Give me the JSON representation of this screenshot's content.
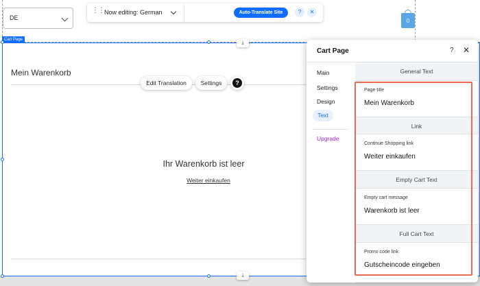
{
  "language_selector": {
    "value": "DE"
  },
  "toolbar": {
    "editing_label": "Now editing: German",
    "auto_translate_label": "Auto-Translate Site",
    "help_label": "?",
    "close_label": "✕"
  },
  "cart_icon": {
    "count": "0"
  },
  "canvas": {
    "frame_label": "Cart Page",
    "page_title": "Mein Warenkorb",
    "edit_translation_label": "Edit Translation",
    "settings_label": "Settings",
    "help_label": "?",
    "empty_heading": "Ihr Warenkorb ist leer",
    "continue_link": "Weiter einkaufen"
  },
  "panel": {
    "title": "Cart Page",
    "help_label": "?",
    "close_label": "✕",
    "nav": [
      {
        "label": "Main"
      },
      {
        "label": "Settings"
      },
      {
        "label": "Design"
      },
      {
        "label": "Text"
      },
      {
        "label": "Upgrade"
      }
    ],
    "active_nav": "Text",
    "sections": [
      {
        "header": "General Text",
        "field_label": "Page title",
        "field_value": "Mein Warenkorb"
      },
      {
        "header": "Link",
        "field_label": "Continue Shopping link",
        "field_value": "Weiter einkaufen"
      },
      {
        "header": "Empty Cart Text",
        "field_label": "Empty cart message",
        "field_value": "Warenkorb ist leer"
      },
      {
        "header": "Full Cart Text",
        "field_label": "Promo code link",
        "field_value": "Gutscheincode eingeben"
      }
    ]
  },
  "colors": {
    "accent": "#116dff",
    "highlight": "#e96a50",
    "upgrade": "#9a27d5",
    "cart_icon": "#5ba6e6"
  }
}
